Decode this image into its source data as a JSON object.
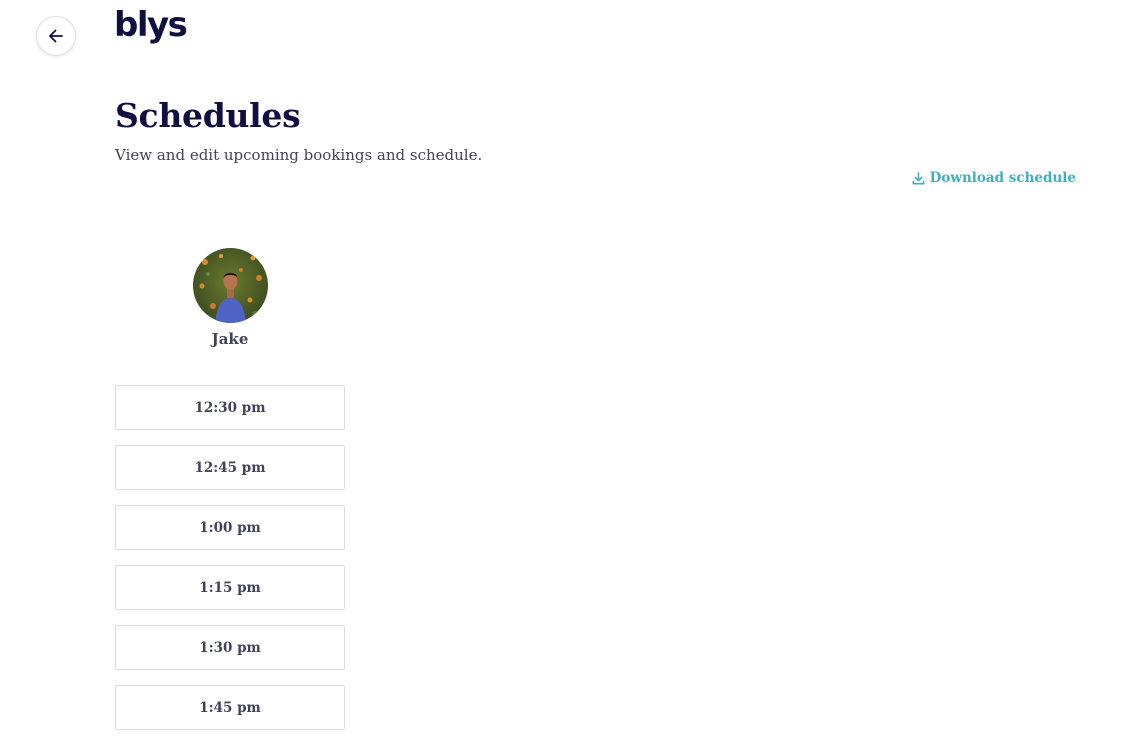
{
  "header": {
    "logo_text": "blys",
    "back_icon": "arrow-left-icon"
  },
  "page": {
    "title": "Schedules",
    "subtitle": "View and edit upcoming bookings and schedule."
  },
  "actions": {
    "download_label": "Download schedule",
    "download_icon": "download-icon"
  },
  "schedule": {
    "pro": {
      "name": "Jake"
    },
    "slots": [
      {
        "time": "12:30 pm"
      },
      {
        "time": "12:45 pm"
      },
      {
        "time": "1:00 pm"
      },
      {
        "time": "1:15 pm"
      },
      {
        "time": "1:30 pm"
      },
      {
        "time": "1:45 pm"
      }
    ]
  },
  "colors": {
    "brand_navy": "#100f42",
    "accent_teal": "#3bb1c2",
    "text_gray": "#41435a",
    "border": "#dcdde3"
  }
}
